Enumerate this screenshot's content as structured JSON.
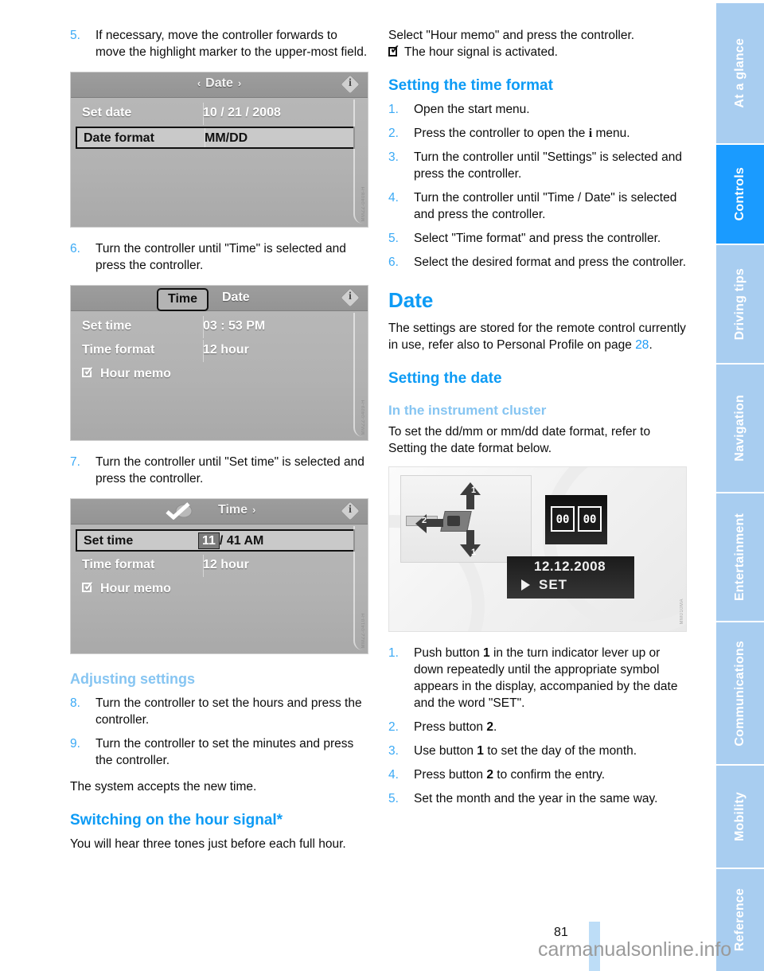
{
  "page_number": "81",
  "watermark": "carmanualsonline.info",
  "colors": {
    "accent_blue": "#0d9bf5",
    "light_blue": "#86c5f2",
    "tab_inactive": "#a8cdf0",
    "tab_active": "#1a9bff"
  },
  "tabs": [
    {
      "label": "At a glance",
      "active": false
    },
    {
      "label": "Controls",
      "active": true
    },
    {
      "label": "Driving tips",
      "active": false
    },
    {
      "label": "Navigation",
      "active": false
    },
    {
      "label": "Entertainment",
      "active": false
    },
    {
      "label": "Communications",
      "active": false
    },
    {
      "label": "Mobility",
      "active": false
    },
    {
      "label": "Reference",
      "active": false
    }
  ],
  "left_column": {
    "step5": {
      "num": "5.",
      "text": "If necessary, move the controller forwards to move the highlight marker to the upper-most field."
    },
    "shot_date": {
      "title": "Date",
      "arrow_left": "‹",
      "arrow_right": "›",
      "info_letter": "i",
      "rows": [
        {
          "label": "Set date",
          "value": "10 / 21 / 2008",
          "highlighted": false
        },
        {
          "label": "Date format",
          "value": "MM/DD",
          "highlighted": true
        }
      ],
      "image_code": "MMZZ-0408-H"
    },
    "step6": {
      "num": "6.",
      "text": "Turn the controller until \"Time\" is selected and press the controller."
    },
    "shot_time": {
      "tab_selected": "Time",
      "tab_other": "Date",
      "info_letter": "i",
      "rows": [
        {
          "label": "Set time",
          "value": "03 : 53 PM",
          "highlighted": false
        },
        {
          "label": "Time format",
          "value": "12 hour",
          "highlighted": false
        }
      ],
      "checkbox_label": "Hour memo",
      "image_code": "MMZZ-0409-H"
    },
    "step7": {
      "num": "7.",
      "text": "Turn the controller until \"Set time\" is selected and press the controller."
    },
    "shot_settime": {
      "title": "Time",
      "arrow_left": "‹",
      "arrow_right": "›",
      "info_letter": "i",
      "rows": [
        {
          "label": "Set time",
          "value_selected": "11",
          "value_rest": "/ 41 AM",
          "highlighted": true
        },
        {
          "label": "Time format",
          "value": "12 hour",
          "highlighted": false
        }
      ],
      "checkbox_label": "Hour memo",
      "image_code": "MMZZ-0410-H"
    },
    "heading_adjusting": "Adjusting settings",
    "step8": {
      "num": "8.",
      "text": "Turn the controller to set the hours and press the controller."
    },
    "step9": {
      "num": "9.",
      "text": "Turn the controller to set the minutes and press the controller."
    },
    "accepts": "The system accepts the new time.",
    "heading_hour_signal": "Switching on the hour signal*",
    "hour_signal_text": "You will hear three tones just before each full hour."
  },
  "right_column": {
    "select_hour_memo": "Select \"Hour memo\" and press the controller.",
    "hour_signal_activated": "The hour signal is activated.",
    "heading_time_format": "Setting the time format",
    "time_format_steps": [
      {
        "num": "1.",
        "text": "Open the start menu."
      },
      {
        "num": "2.",
        "text_before": "Press the controller to open the ",
        "inline_icon": "i",
        "text_after": " menu."
      },
      {
        "num": "3.",
        "text": "Turn the controller until \"Settings\" is selected and press the controller."
      },
      {
        "num": "4.",
        "text": "Turn the controller until \"Time / Date\" is selected and press the controller."
      },
      {
        "num": "5.",
        "text": "Select \"Time format\" and press the controller."
      },
      {
        "num": "6.",
        "text": "Select the desired format and press the controller."
      }
    ],
    "heading_date": "Date",
    "date_intro_1": "The settings are stored for the remote control currently in use, refer also to Personal Profile on page ",
    "date_intro_pageref": "28",
    "date_intro_2": ".",
    "heading_setting_date": "Setting the date",
    "heading_instrument_cluster": "In the instrument cluster",
    "cluster_text": "To set the dd/mm or mm/dd date format, refer to Setting the date format below.",
    "photo": {
      "callout_1_top": "1",
      "callout_1_bottom": "1",
      "callout_2": "2",
      "digit_left": "00",
      "digit_right": "00",
      "lcd_date": "12.12.2008",
      "lcd_set": "SET",
      "image_code": "MM010MA"
    },
    "cluster_steps": [
      {
        "num": "1.",
        "parts": [
          "Push button ",
          "1",
          " in the turn indicator lever up or down repeatedly until the appropriate symbol appears in the display, accompanied by the date and the word \"SET\"."
        ]
      },
      {
        "num": "2.",
        "parts": [
          "Press button ",
          "2",
          "."
        ]
      },
      {
        "num": "3.",
        "parts": [
          "Use button ",
          "1",
          " to set the day of the month."
        ]
      },
      {
        "num": "4.",
        "parts": [
          "Press button ",
          "2",
          " to confirm the entry."
        ]
      },
      {
        "num": "5.",
        "parts": [
          "Set the month and the year in the same way.",
          "",
          ""
        ]
      }
    ]
  }
}
